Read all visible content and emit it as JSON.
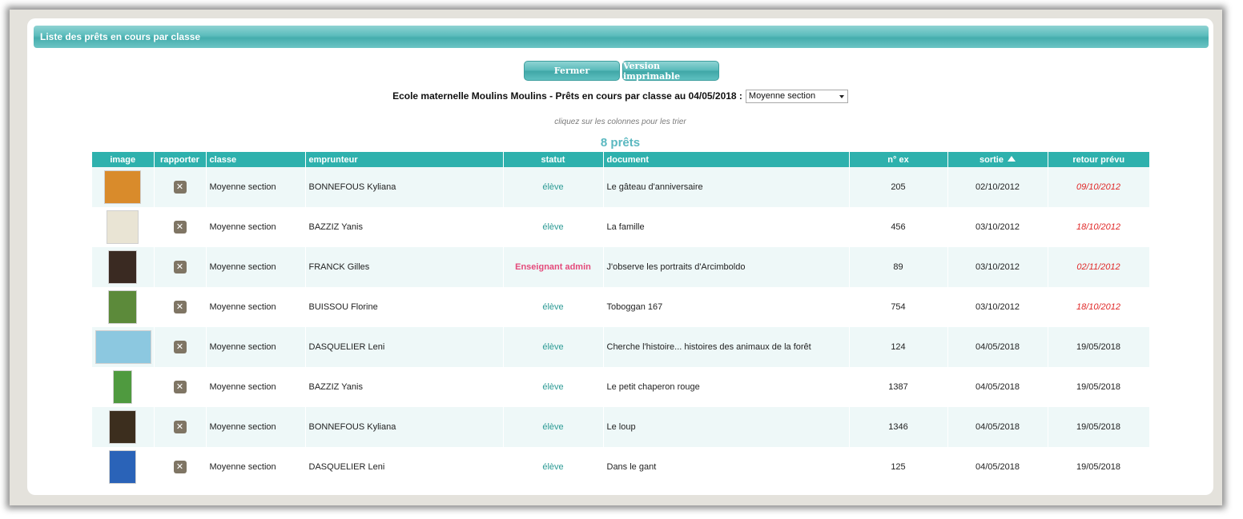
{
  "panel": {
    "title": "Liste des prêts en cours par classe"
  },
  "toolbar": {
    "close_label": "Fermer",
    "print_label": "Version imprimable"
  },
  "heading": {
    "text": "Ecole maternelle Moulins Moulins - Prêts en cours par classe au 04/05/2018 :",
    "class_select_value": "Moyenne section"
  },
  "hint": "cliquez sur les colonnes pour les trier",
  "count_label": "8 prêts",
  "table": {
    "headers": {
      "image": "image",
      "rapporter": "rapporter",
      "classe": "classe",
      "emprunteur": "emprunteur",
      "statut": "statut",
      "document": "document",
      "nex": "n° ex",
      "sortie": "sortie",
      "retour": "retour prévu"
    },
    "sort_column": "sortie",
    "rows": [
      {
        "classe": "Moyenne section",
        "emprunteur": "BONNEFOUS Kyliana",
        "statut": "élève",
        "document": "Le gâteau d'anniversaire",
        "nex": "205",
        "sortie": "02/10/2012",
        "retour": "09/10/2012",
        "late": true,
        "cover_color": "#d98b2b"
      },
      {
        "classe": "Moyenne section",
        "emprunteur": "BAZZIZ Yanis",
        "statut": "élève",
        "document": "La famille",
        "nex": "456",
        "sortie": "03/10/2012",
        "retour": "18/10/2012",
        "late": true,
        "cover_color": "#e9e4d4"
      },
      {
        "classe": "Moyenne section",
        "emprunteur": "FRANCK Gilles",
        "statut": "Enseignant admin",
        "document": "J'observe les portraits d'Arcimboldo",
        "nex": "89",
        "sortie": "03/10/2012",
        "retour": "02/11/2012",
        "late": true,
        "cover_color": "#3a2a22"
      },
      {
        "classe": "Moyenne section",
        "emprunteur": "BUISSOU Florine",
        "statut": "élève",
        "document": "Toboggan 167",
        "nex": "754",
        "sortie": "03/10/2012",
        "retour": "18/10/2012",
        "late": true,
        "cover_color": "#5c8a3a"
      },
      {
        "classe": "Moyenne section",
        "emprunteur": "DASQUELIER Leni",
        "statut": "élève",
        "document": "Cherche l'histoire... histoires des animaux de la forêt",
        "nex": "124",
        "sortie": "04/05/2018",
        "retour": "19/05/2018",
        "late": false,
        "cover_color": "#8cc8e0"
      },
      {
        "classe": "Moyenne section",
        "emprunteur": "BAZZIZ Yanis",
        "statut": "élève",
        "document": "Le petit chaperon rouge",
        "nex": "1387",
        "sortie": "04/05/2018",
        "retour": "19/05/2018",
        "late": false,
        "cover_color": "#4f9a3f"
      },
      {
        "classe": "Moyenne section",
        "emprunteur": "BONNEFOUS Kyliana",
        "statut": "élève",
        "document": "Le loup",
        "nex": "1346",
        "sortie": "04/05/2018",
        "retour": "19/05/2018",
        "late": false,
        "cover_color": "#3c2e1e"
      },
      {
        "classe": "Moyenne section",
        "emprunteur": "DASQUELIER Leni",
        "statut": "élève",
        "document": "Dans le gant",
        "nex": "125",
        "sortie": "04/05/2018",
        "retour": "19/05/2018",
        "late": false,
        "cover_color": "#2a63b8"
      }
    ]
  },
  "icons": {
    "return": "remove-icon",
    "sort": "sort-ascending-icon"
  },
  "colors": {
    "accent": "#2eb1ad",
    "late": "#e02828",
    "admin": "#e44a7b",
    "count": "#5ab8c0"
  }
}
